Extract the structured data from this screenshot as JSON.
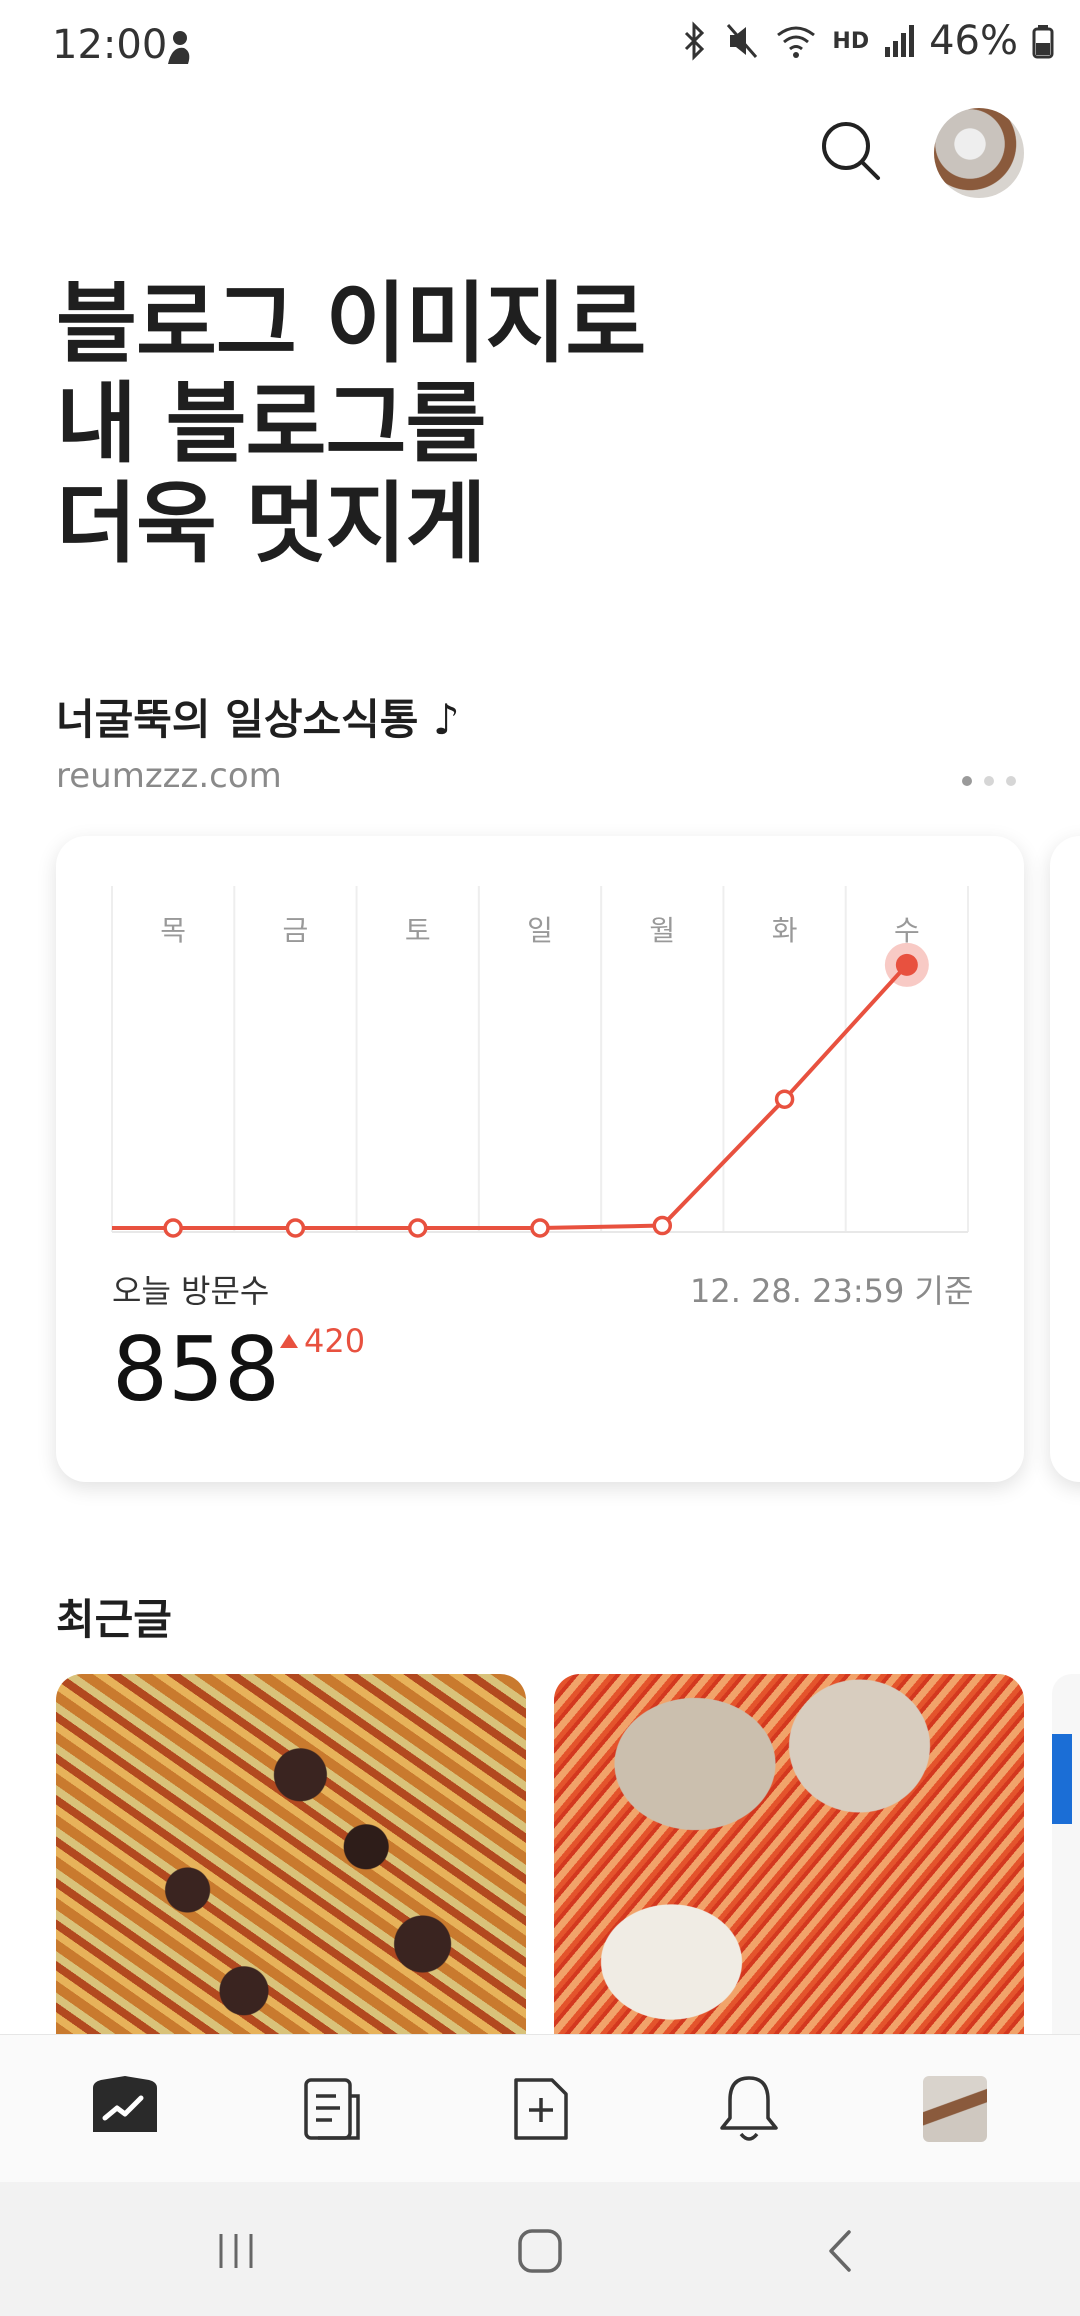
{
  "status_bar": {
    "time": "12:00",
    "battery": "46%",
    "network_label": "HD"
  },
  "headline": {
    "lines": [
      "블로그 이미지로",
      "내 블로그를",
      "더욱 멋지게"
    ]
  },
  "blog": {
    "name": "너굴뚝의 일상소식통 ♪",
    "url": "reumzzz.com"
  },
  "stats_card": {
    "visits_label": "오늘 방문수",
    "timestamp": "12. 28. 23:59 기준",
    "count": "858",
    "delta": "420"
  },
  "chart_data": {
    "type": "line",
    "categories": [
      "목",
      "금",
      "토",
      "일",
      "월",
      "화",
      "수"
    ],
    "values": [
      0,
      0,
      0,
      0,
      8,
      420,
      858
    ],
    "ylim": [
      0,
      900
    ],
    "grid": true,
    "color": "#e8513f"
  },
  "recent": {
    "title": "최근글"
  },
  "bottom_nav": {
    "items": [
      {
        "icon": "stats-icon",
        "active": true
      },
      {
        "icon": "document-icon"
      },
      {
        "icon": "new-post-icon"
      },
      {
        "icon": "bell-icon"
      },
      {
        "icon": "profile-thumbnail"
      }
    ]
  },
  "system_nav": {
    "icons": [
      "recent-apps-icon",
      "home-icon",
      "back-icon"
    ]
  },
  "colors": {
    "accent": "#e8513f",
    "text": "#1f1f1f",
    "muted": "#8a8a8a"
  }
}
